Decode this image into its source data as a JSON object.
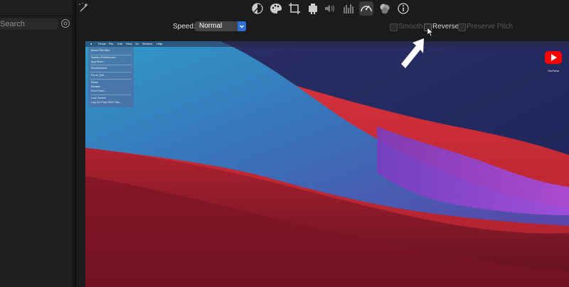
{
  "sidebar": {
    "search_placeholder": "Search"
  },
  "toolbar": {
    "icons": [
      "color-balance-icon",
      "color-palette-icon",
      "crop-icon",
      "camera-icon",
      "volume-icon",
      "equalizer-icon",
      "speed-icon",
      "noise-reduction-icon",
      "info-icon"
    ],
    "active": "speed-icon"
  },
  "speed": {
    "label": "Speed:",
    "value": "Normal",
    "smooth_label": "Smooth",
    "reverse_label": "Reverse",
    "preserve_pitch_label": "Preserve Pitch"
  },
  "viewer": {
    "menubar": [
      "Finder",
      "File",
      "Edit",
      "View",
      "Go",
      "Window",
      "Help"
    ],
    "apple_menu": [
      "About This Mac",
      "System Preferences...",
      "App Store...",
      "Recent Items",
      "Force Quit...",
      "Sleep",
      "Restart...",
      "Shut Down...",
      "Lock Screen",
      "Log Out Foxy Tech Tips..."
    ],
    "youtube_label": "YouTube"
  },
  "colors": {
    "accent": "#2d6fd6",
    "youtube": "#ff0000"
  }
}
